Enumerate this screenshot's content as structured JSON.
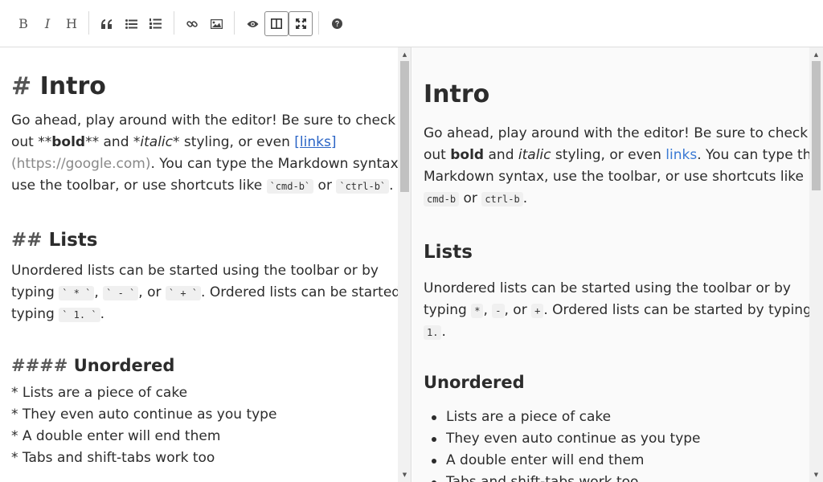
{
  "toolbar": {
    "buttons": [
      {
        "name": "bold",
        "label": "B"
      },
      {
        "name": "italic",
        "label": "I"
      },
      {
        "name": "heading",
        "label": "H"
      }
    ]
  },
  "editor": {
    "h1_marker": "# ",
    "h1_text": "Intro",
    "p1": {
      "l1": "Go ahead, play around with the editor! Be sure to check",
      "l2_a": "out **",
      "l2_bold": "bold",
      "l2_b": "** and ",
      "l2_italic": "*italic*",
      "l2_c": " styling, or even ",
      "l2_link": "[links]",
      "l3_url": "(https://google.com)",
      "l3_b": ". You can type the Markdown syntax,",
      "l4_a": "use the toolbar, or use shortcuts like ",
      "l4_code1": "`cmd-b`",
      "l4_mid": " or ",
      "l4_code2": "`ctrl-b`",
      "l4_end": "."
    },
    "h2_marker": "## ",
    "h2_text": "Lists",
    "p2": {
      "l1": "Unordered lists can be started using the toolbar or by",
      "l2_a": "typing ",
      "code1": "` * `",
      "sep1": ", ",
      "code2": "` - `",
      "sep2": ", or ",
      "code3": "` + `",
      "l2_b": ". Ordered lists can be started by",
      "l3_a": "typing ",
      "code4": "` 1. `",
      "l3_b": "."
    },
    "h4_marker": "#### ",
    "h4_text": "Unordered",
    "list": [
      "* Lists are a piece of cake",
      "* They even auto continue as you type",
      "* A double enter will end them",
      "* Tabs and shift-tabs work too"
    ]
  },
  "preview": {
    "h1": "Intro",
    "p1": {
      "l1": "Go ahead, play around with the editor! Be sure to check",
      "l2_a": "out ",
      "l2_bold": "bold",
      "l2_b": " and ",
      "l2_italic": "italic",
      "l2_c": " styling, or even ",
      "l2_link": "links",
      "l2_d": ". You can type the",
      "l3": "Markdown syntax, use the toolbar, or use shortcuts like",
      "l4_code1": "cmd-b",
      "l4_mid": " or ",
      "l4_code2": "ctrl-b",
      "l4_end": "."
    },
    "h2": "Lists",
    "p2": {
      "l1": "Unordered lists can be started using the toolbar or by",
      "l2_a": "typing ",
      "code1": "*",
      "sep1": ", ",
      "code2": "-",
      "sep2": ", or ",
      "code3": "+",
      "l2_b": ". Ordered lists can be started by typing",
      "code4": "1.",
      "l3_end": "."
    },
    "h4": "Unordered",
    "list": [
      "Lists are a piece of cake",
      "They even auto continue as you type",
      "A double enter will end them",
      "Tabs and shift-tabs work too"
    ]
  }
}
